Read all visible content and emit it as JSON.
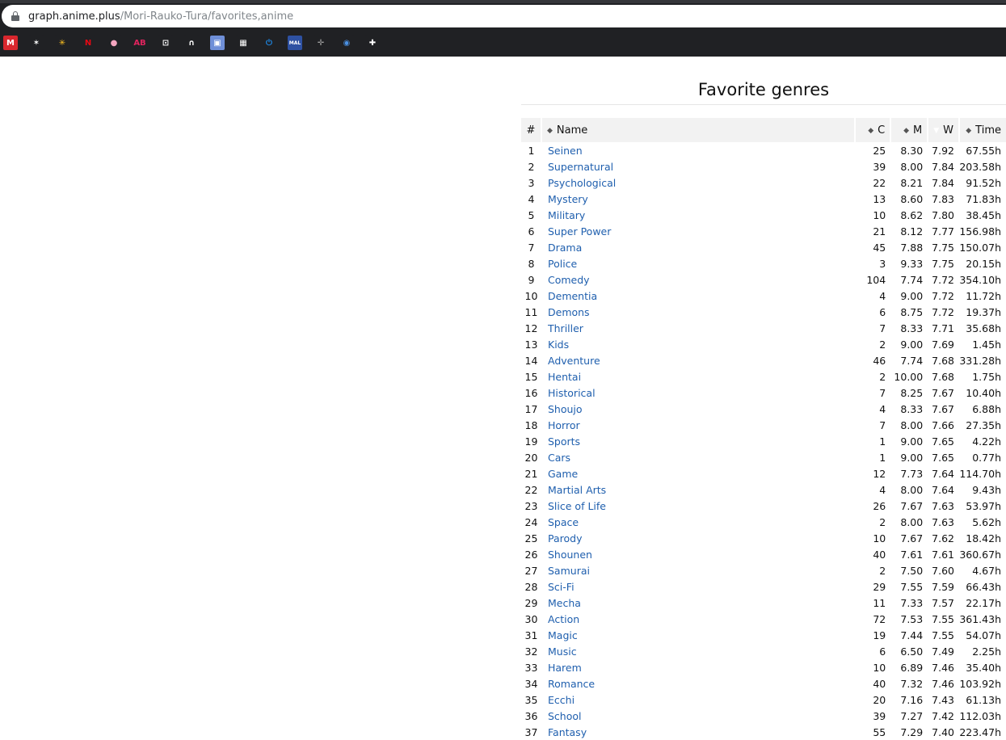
{
  "browser": {
    "url_host": "graph.anime.plus",
    "url_path": "/Mori-Rauko-Tura/favorites,anime",
    "bookmarks": [
      {
        "icon": "mega-m-icon",
        "glyph": "M",
        "bg": "#d9272e",
        "fg": "#ffffff"
      },
      {
        "icon": "space-invader-icon",
        "glyph": "✶",
        "bg": "#202124",
        "fg": "#ffffff"
      },
      {
        "icon": "walmart-spark-icon",
        "glyph": "✳",
        "bg": "#202124",
        "fg": "#ffc220"
      },
      {
        "icon": "netflix-icon",
        "glyph": "N",
        "bg": "#202124",
        "fg": "#e50914"
      },
      {
        "icon": "pink-blob-icon",
        "glyph": "●",
        "bg": "#202124",
        "fg": "#f4a6c0"
      },
      {
        "icon": "ab-icon",
        "glyph": "AB",
        "bg": "#202124",
        "fg": "#e0245e"
      },
      {
        "icon": "brackets-icon",
        "glyph": "⊡",
        "bg": "#202124",
        "fg": "#ffffff"
      },
      {
        "icon": "headphones-icon",
        "glyph": "∩",
        "bg": "#202124",
        "fg": "#ffffff"
      },
      {
        "icon": "photo-app-icon",
        "glyph": "▣",
        "bg": "#6f8fd8",
        "fg": "#ffffff"
      },
      {
        "icon": "film-strip-icon",
        "glyph": "▦",
        "bg": "#202124",
        "fg": "#ffffff"
      },
      {
        "icon": "power-icon",
        "glyph": "⏻",
        "bg": "#202124",
        "fg": "#1e88e5"
      },
      {
        "icon": "mal-icon",
        "glyph": "MAL",
        "bg": "#2e51a2",
        "fg": "#ffffff"
      },
      {
        "icon": "crosshair-icon",
        "glyph": "✛",
        "bg": "#202124",
        "fg": "#9e9e9e"
      },
      {
        "icon": "globe-icon",
        "glyph": "◉",
        "bg": "#202124",
        "fg": "#4a90e2"
      },
      {
        "icon": "puzzle-extension-icon",
        "glyph": "✚",
        "bg": "#202124",
        "fg": "#ffffff"
      }
    ]
  },
  "section": {
    "title": "Favorite genres"
  },
  "table": {
    "columns": {
      "rank": "#",
      "name": "Name",
      "count": "C",
      "mean": "M",
      "weighted": "W",
      "time": "Time"
    },
    "sort_column": "W",
    "accent_color": "#2f7fd0",
    "link_color": "#1f5fae",
    "rows": [
      [
        "1",
        "Seinen",
        "25",
        "8.30",
        "7.92",
        "67.55h"
      ],
      [
        "2",
        "Supernatural",
        "39",
        "8.00",
        "7.84",
        "203.58h"
      ],
      [
        "3",
        "Psychological",
        "22",
        "8.21",
        "7.84",
        "91.52h"
      ],
      [
        "4",
        "Mystery",
        "13",
        "8.60",
        "7.83",
        "71.83h"
      ],
      [
        "5",
        "Military",
        "10",
        "8.62",
        "7.80",
        "38.45h"
      ],
      [
        "6",
        "Super Power",
        "21",
        "8.12",
        "7.77",
        "156.98h"
      ],
      [
        "7",
        "Drama",
        "45",
        "7.88",
        "7.75",
        "150.07h"
      ],
      [
        "8",
        "Police",
        "3",
        "9.33",
        "7.75",
        "20.15h"
      ],
      [
        "9",
        "Comedy",
        "104",
        "7.74",
        "7.72",
        "354.10h"
      ],
      [
        "10",
        "Dementia",
        "4",
        "9.00",
        "7.72",
        "11.72h"
      ],
      [
        "11",
        "Demons",
        "6",
        "8.75",
        "7.72",
        "19.37h"
      ],
      [
        "12",
        "Thriller",
        "7",
        "8.33",
        "7.71",
        "35.68h"
      ],
      [
        "13",
        "Kids",
        "2",
        "9.00",
        "7.69",
        "1.45h"
      ],
      [
        "14",
        "Adventure",
        "46",
        "7.74",
        "7.68",
        "331.28h"
      ],
      [
        "15",
        "Hentai",
        "2",
        "10.00",
        "7.68",
        "1.75h"
      ],
      [
        "16",
        "Historical",
        "7",
        "8.25",
        "7.67",
        "10.40h"
      ],
      [
        "17",
        "Shoujo",
        "4",
        "8.33",
        "7.67",
        "6.88h"
      ],
      [
        "18",
        "Horror",
        "7",
        "8.00",
        "7.66",
        "27.35h"
      ],
      [
        "19",
        "Sports",
        "1",
        "9.00",
        "7.65",
        "4.22h"
      ],
      [
        "20",
        "Cars",
        "1",
        "9.00",
        "7.65",
        "0.77h"
      ],
      [
        "21",
        "Game",
        "12",
        "7.73",
        "7.64",
        "114.70h"
      ],
      [
        "22",
        "Martial Arts",
        "4",
        "8.00",
        "7.64",
        "9.43h"
      ],
      [
        "23",
        "Slice of Life",
        "26",
        "7.67",
        "7.63",
        "53.97h"
      ],
      [
        "24",
        "Space",
        "2",
        "8.00",
        "7.63",
        "5.62h"
      ],
      [
        "25",
        "Parody",
        "10",
        "7.67",
        "7.62",
        "18.42h"
      ],
      [
        "26",
        "Shounen",
        "40",
        "7.61",
        "7.61",
        "360.67h"
      ],
      [
        "27",
        "Samurai",
        "2",
        "7.50",
        "7.60",
        "4.67h"
      ],
      [
        "28",
        "Sci-Fi",
        "29",
        "7.55",
        "7.59",
        "66.43h"
      ],
      [
        "29",
        "Mecha",
        "11",
        "7.33",
        "7.57",
        "22.17h"
      ],
      [
        "30",
        "Action",
        "72",
        "7.53",
        "7.55",
        "361.43h"
      ],
      [
        "31",
        "Magic",
        "19",
        "7.44",
        "7.55",
        "54.07h"
      ],
      [
        "32",
        "Music",
        "6",
        "6.50",
        "7.49",
        "2.25h"
      ],
      [
        "33",
        "Harem",
        "10",
        "6.89",
        "7.46",
        "35.40h"
      ],
      [
        "34",
        "Romance",
        "40",
        "7.32",
        "7.46",
        "103.92h"
      ],
      [
        "35",
        "Ecchi",
        "20",
        "7.16",
        "7.43",
        "61.13h"
      ],
      [
        "36",
        "School",
        "39",
        "7.27",
        "7.42",
        "112.03h"
      ],
      [
        "37",
        "Fantasy",
        "55",
        "7.29",
        "7.40",
        "223.47h"
      ]
    ]
  }
}
